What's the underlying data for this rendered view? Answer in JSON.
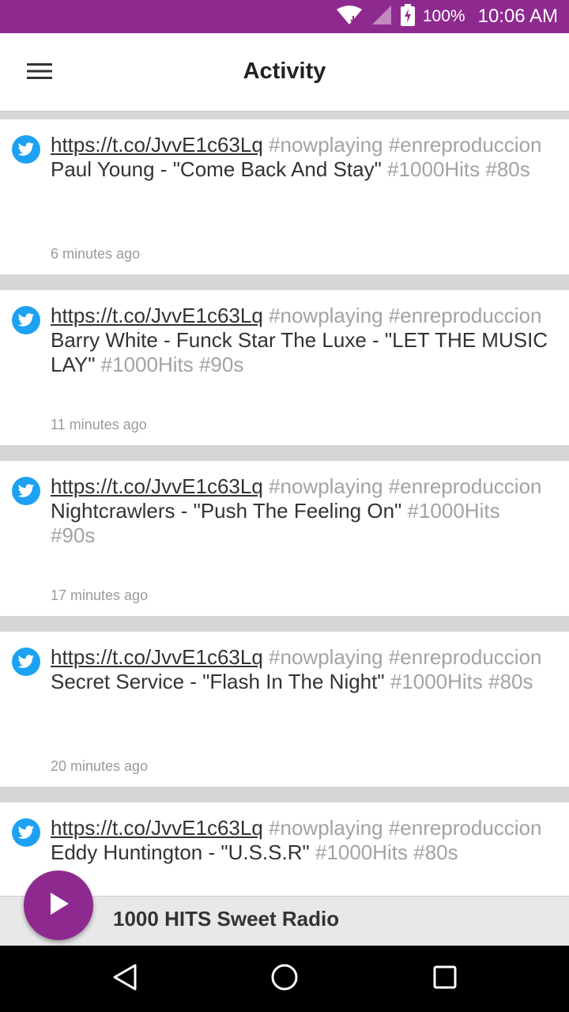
{
  "status_bar": {
    "battery": "100%",
    "time": "10:06 AM"
  },
  "header": {
    "title": "Activity"
  },
  "feed": [
    {
      "link": "https://t.co/JvvE1c63Lq",
      "tag_lead": " #nowplaying #enreproduccion ",
      "song": "Paul Young - \"Come Back And Stay\"",
      "tag_tail": " #1000Hits #80s",
      "time": "6 minutes ago"
    },
    {
      "link": "https://t.co/JvvE1c63Lq",
      "tag_lead": " #nowplaying #enreproduccion ",
      "song": "Barry White - Funck Star The Luxe - \"LET THE MUSIC LAY\"",
      "tag_tail": " #1000Hits #90s",
      "time": "11 minutes ago"
    },
    {
      "link": "https://t.co/JvvE1c63Lq",
      "tag_lead": " #nowplaying #enreproduccion ",
      "song": "Nightcrawlers - \"Push The Feeling On\"",
      "tag_tail": " #1000Hits #90s",
      "time": "17 minutes ago"
    },
    {
      "link": "https://t.co/JvvE1c63Lq",
      "tag_lead": " #nowplaying #enreproduccion ",
      "song": "Secret Service - \"Flash In The Night\"",
      "tag_tail": " #1000Hits #80s",
      "time": "20 minutes ago"
    },
    {
      "link": "https://t.co/JvvE1c63Lq",
      "tag_lead": " #nowplaying #enreproduccion ",
      "song": "Eddy Huntington - \"U.S.S.R\"",
      "tag_tail": " #1000Hits #80s",
      "time": ""
    }
  ],
  "player": {
    "station": "1000 HITS Sweet Radio"
  },
  "icons": {
    "menu": "hamburger-menu-icon",
    "twitter": "twitter-bird-icon",
    "play": "play-icon",
    "back": "back-triangle-icon",
    "home": "home-circle-icon",
    "recents": "recents-square-icon"
  },
  "colors": {
    "accent": "#8e2a8f",
    "twitter": "#1da1f2",
    "hashtag": "#a3a3a3"
  }
}
